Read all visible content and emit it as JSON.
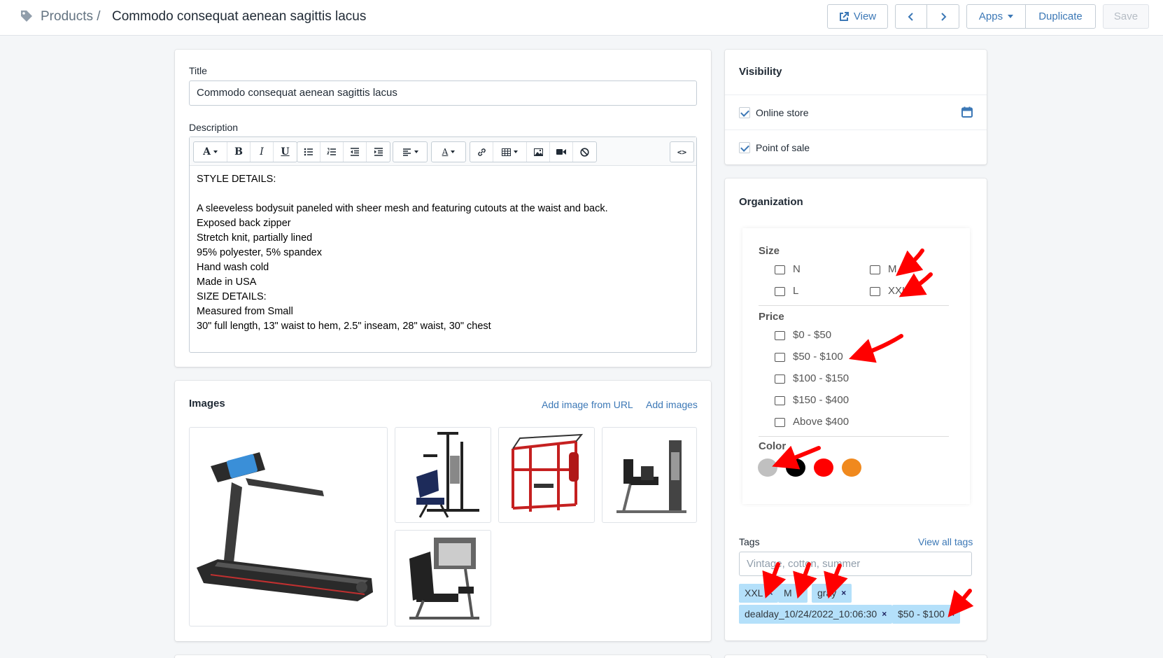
{
  "header": {
    "breadcrumb_link": "Products /",
    "title": "Commodo consequat aenean sagittis lacus",
    "view_label": "View",
    "apps_label": "Apps",
    "duplicate_label": "Duplicate",
    "save_label": "Save",
    "icons": [
      "tag-icon",
      "external-link-icon",
      "chevron-left-icon",
      "chevron-right-icon",
      "caret-down-icon"
    ]
  },
  "product": {
    "title_label": "Title",
    "title_value": "Commodo consequat aenean sagittis lacus",
    "description_label": "Description",
    "toolbar_icons": [
      "font-icon",
      "bold-icon",
      "italic-icon",
      "underline-icon",
      "bullet-list-icon",
      "numbered-list-icon",
      "outdent-icon",
      "indent-icon",
      "align-icon",
      "text-color-icon",
      "link-icon",
      "table-icon",
      "image-icon",
      "video-icon",
      "clear-format-icon",
      "code-view-icon"
    ],
    "description_lines": [
      "STYLE DETAILS:",
      "",
      "A sleeveless bodysuit paneled with sheer mesh and featuring cutouts at the waist and back.",
      "Exposed back zipper",
      "Stretch knit, partially lined",
      "95% polyester, 5% spandex",
      "Hand wash cold",
      "Made in USA",
      "SIZE DETAILS:",
      "Measured from Small",
      "30\" full length, 13\" waist to hem, 2.5\" inseam, 28\" waist, 30\" chest"
    ]
  },
  "images": {
    "title": "Images",
    "add_from_url": "Add image from URL",
    "add_images": "Add images",
    "items": [
      "treadmill",
      "home-gym",
      "rig-station",
      "hip-machine",
      "leg-extension"
    ]
  },
  "visibility": {
    "title": "Visibility",
    "channels": [
      {
        "label": "Online store",
        "checked": true
      },
      {
        "label": "Point of sale",
        "checked": true
      }
    ]
  },
  "organization": {
    "title": "Organization",
    "size_heading": "Size",
    "sizes": [
      "N",
      "M",
      "L",
      "XXL"
    ],
    "price_heading": "Price",
    "prices": [
      "$0 - $50",
      "$50 - $100",
      "$100 - $150",
      "$150 - $400",
      "Above $400"
    ],
    "color_heading": "Color",
    "colors": [
      "#c0c0c0",
      "#000000",
      "#ff0000",
      "#f0891e"
    ]
  },
  "tags": {
    "label": "Tags",
    "view_all": "View all tags",
    "placeholder": "Vintage, cotton, summer",
    "items": [
      "XXL",
      "M",
      "gray",
      "dealday_10/24/2022_10:06:30",
      "$50 - $100"
    ],
    "remove_glyph": "×"
  },
  "colors": {
    "link": "#3c78b6",
    "tag_bg": "#b4e0fa",
    "annotation_arrow": "#ff0000"
  }
}
